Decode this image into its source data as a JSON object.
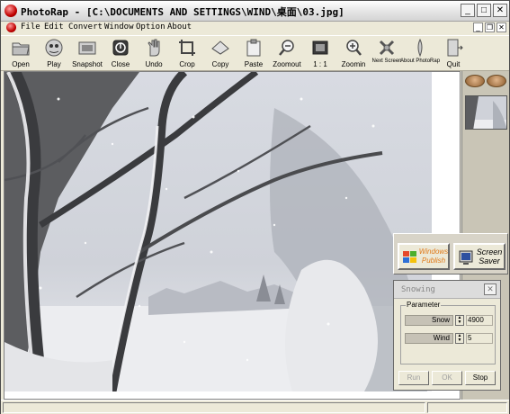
{
  "window": {
    "title": "PhotoRap - [C:\\DOCUMENTS AND SETTINGS\\WIND\\桌面\\03.jpg]",
    "controls": {
      "minimize": "_",
      "maximize": "□",
      "close": "✕"
    }
  },
  "menu": {
    "items": [
      "File",
      "Edit",
      "Convert",
      "Window",
      "Option",
      "About"
    ],
    "doc_controls": {
      "minimize": "_",
      "restore": "❐",
      "close": "✕"
    }
  },
  "toolbar": {
    "buttons": [
      {
        "label": "Open",
        "icon": "folder-icon"
      },
      {
        "label": "Play",
        "icon": "play-icon"
      },
      {
        "label": "Snapshot",
        "icon": "camera-icon"
      },
      {
        "label": "Close",
        "icon": "close-doc-icon"
      },
      {
        "label": "Undo",
        "icon": "hand-icon"
      },
      {
        "label": "Crop",
        "icon": "crop-icon"
      },
      {
        "label": "Copy",
        "icon": "copy-icon"
      },
      {
        "label": "Paste",
        "icon": "clipboard-icon"
      },
      {
        "label": "Zoomout",
        "icon": "zoom-out-icon"
      },
      {
        "label": "1 : 1",
        "icon": "actual-size-icon"
      },
      {
        "label": "Zoomin",
        "icon": "zoom-in-icon"
      },
      {
        "label": "Next Screen",
        "icon": "next-screen-icon"
      },
      {
        "label": "About PhotoRap",
        "icon": "about-icon"
      },
      {
        "label": "Quit",
        "icon": "exit-door-icon"
      }
    ]
  },
  "wallpaper_panel": {
    "windows_button": "Windows Publish",
    "screensaver_button": "Screen Saver"
  },
  "snowing_dialog": {
    "title": "Snowing",
    "group_label": "Parameter",
    "params": [
      {
        "name": "Snow",
        "value": "4900"
      },
      {
        "name": "Wind",
        "value": "5"
      }
    ],
    "buttons": {
      "run": "Run",
      "ok": "OK",
      "stop": "Stop"
    }
  }
}
